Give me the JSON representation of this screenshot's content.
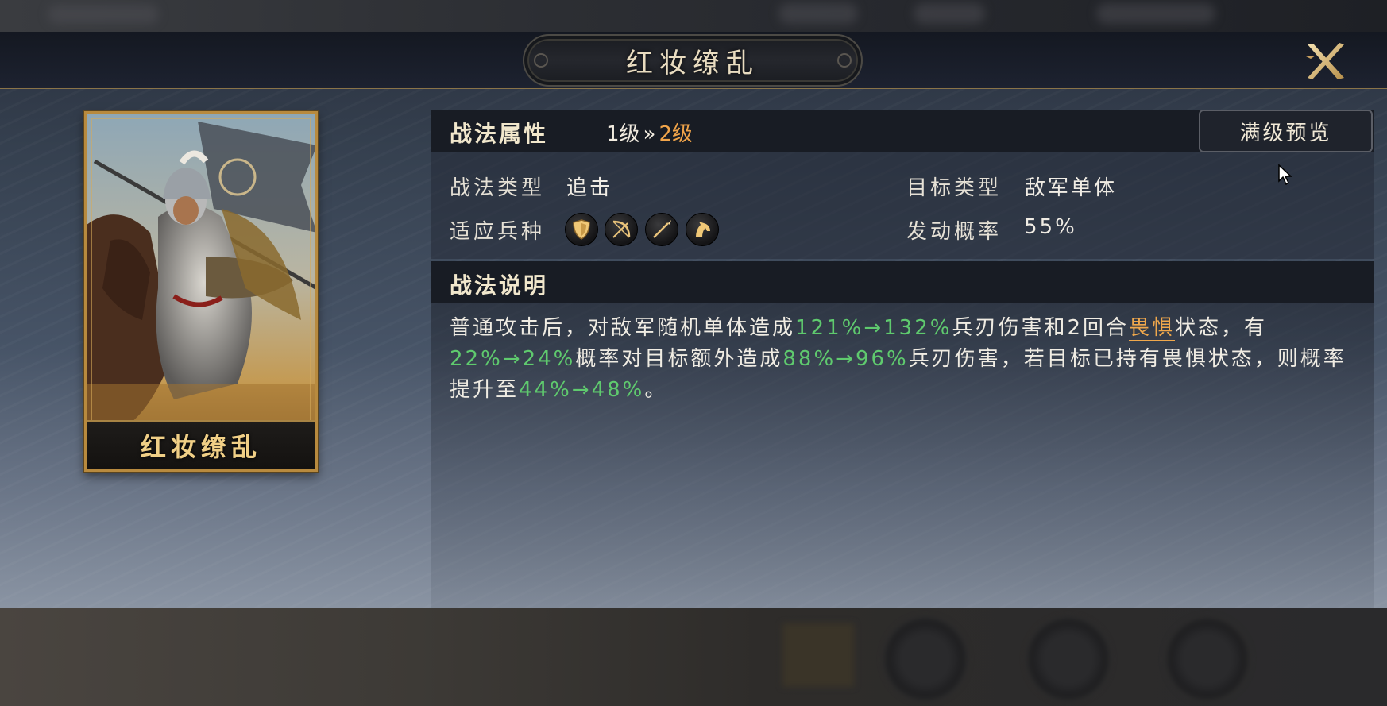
{
  "window": {
    "title": "红妆缭乱"
  },
  "card": {
    "name": "红妆缭乱"
  },
  "attributes": {
    "section_title": "战法属性",
    "level_from": "1级",
    "level_arrow": "»",
    "level_to": "2级",
    "max_preview_label": "满级预览",
    "tactic_type_label": "战法类型",
    "tactic_type_value": "追击",
    "target_type_label": "目标类型",
    "target_type_value": "敌军单体",
    "troop_label": "适应兵种",
    "trigger_rate_label": "发动概率",
    "trigger_rate_value": "55%",
    "troop_icons": [
      "shield-icon",
      "bow-icon",
      "spear-icon",
      "horse-icon"
    ]
  },
  "description": {
    "section_title": "战法说明",
    "segments": [
      {
        "text": "普通攻击后，对敌军随机单体造成",
        "style": "normal"
      },
      {
        "text": "121%→132%",
        "style": "green"
      },
      {
        "text": "兵刃伤害和2回合",
        "style": "normal"
      },
      {
        "text": "畏惧",
        "style": "orange"
      },
      {
        "text": "状态，有",
        "style": "normal"
      },
      {
        "text": "22%→24%",
        "style": "green"
      },
      {
        "text": "概率对目标额外造成",
        "style": "normal"
      },
      {
        "text": "88%→96%",
        "style": "green"
      },
      {
        "text": "兵刃伤害，若目标已持有畏惧状态，则概率提升至",
        "style": "normal"
      },
      {
        "text": "44%→48%",
        "style": "green"
      },
      {
        "text": "。",
        "style": "normal"
      }
    ]
  },
  "colors": {
    "accent_gold": "#b88a3e",
    "level_orange": "#f2a54a",
    "value_green": "#5fca6e"
  }
}
